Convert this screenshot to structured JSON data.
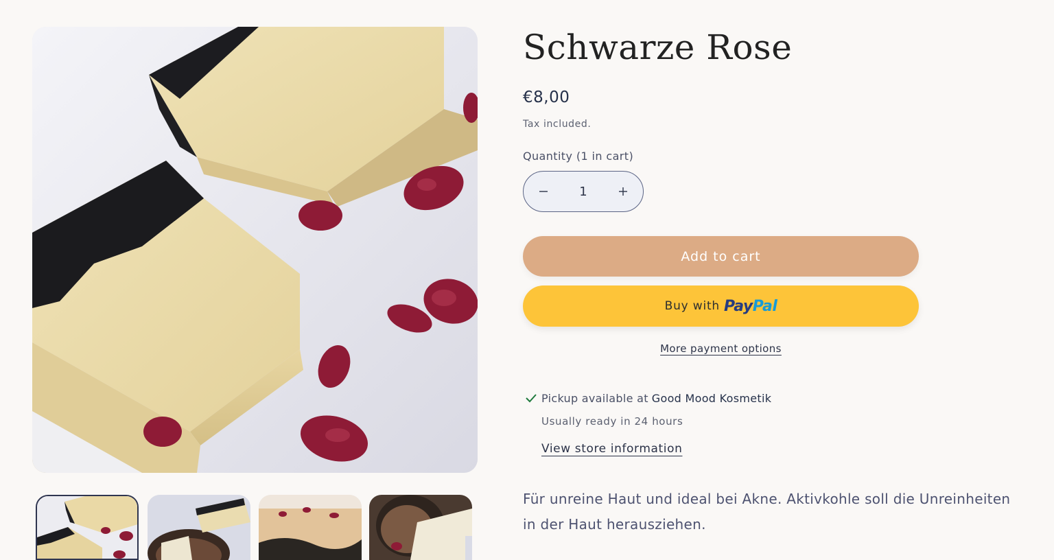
{
  "product": {
    "title": "Schwarze Rose",
    "price": "€8,00",
    "tax_note": "Tax included.",
    "quantity_label": "Quantity (1 in cart)",
    "quantity_value": "1",
    "decrease_icon": "minus-icon",
    "increase_icon": "plus-icon",
    "add_to_cart_label": "Add to cart",
    "buy_with_label": "Buy with",
    "paypal_logo": {
      "part1": "Pay",
      "part2": "Pal"
    },
    "more_payment_options": "More payment options",
    "description": "Für unreine Haut und ideal bei Akne. Aktivkohle soll die Unreinheiten in der Haut herausziehen."
  },
  "pickup": {
    "status_icon": "check-icon",
    "prefix": "Pickup available at",
    "store_name": "Good Mood Kosmetik",
    "ready_time": "Usually ready in 24 hours",
    "view_store_link": "View store information"
  },
  "colors": {
    "add_to_cart_bg": "#dcab85",
    "paypal_bg": "#fdc439",
    "check": "#1f7a3d",
    "page_bg": "#faf8f6"
  }
}
